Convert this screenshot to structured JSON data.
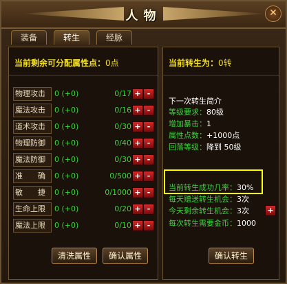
{
  "window": {
    "title": "人物",
    "close_label": "✕"
  },
  "tabs": [
    {
      "label": "装备"
    },
    {
      "label": "转生"
    },
    {
      "label": "经脉"
    }
  ],
  "left": {
    "points_label": "当前剩余可分配属性点：",
    "points_value": "0点",
    "attributes": [
      {
        "name": "物理攻击",
        "current": "0 (+0)",
        "max": "0/17"
      },
      {
        "name": "魔法攻击",
        "current": "0 (+0)",
        "max": "0/16"
      },
      {
        "name": "道术攻击",
        "current": "0 (+0)",
        "max": "0/30"
      },
      {
        "name": "物理防御",
        "current": "0 (+0)",
        "max": "0/40"
      },
      {
        "name": "魔法防御",
        "current": "0 (+0)",
        "max": "0/30"
      },
      {
        "name": "准　　确",
        "current": "0 (+0)",
        "max": "0/500"
      },
      {
        "name": "敏　　捷",
        "current": "0 (+0)",
        "max": "0/1000"
      },
      {
        "name": "生命上限",
        "current": "0 (+0)",
        "max": "0/20"
      },
      {
        "name": "魔法上限",
        "current": "0 (+0)",
        "max": "0/10"
      }
    ],
    "plus_label": "+",
    "minus_label": "-",
    "reset_button": "清洗属性",
    "confirm_button": "确认属性"
  },
  "right": {
    "rebirth_label": "当前转生为：",
    "rebirth_value": "0转",
    "next_title": "下一次转生简介",
    "level_req_label": "等级要求：",
    "level_req_value": "80级",
    "crit_label": "增加暴击：",
    "crit_value": "1",
    "points_label": "属性点数：",
    "points_value": "+1000点",
    "fallback_label": "回落等级：",
    "fallback_value": "降到 50级",
    "success_label": "当前转生成功几率：",
    "success_value": "30%",
    "daily_label": "每天赠送转生机会：",
    "daily_value": "3次",
    "remaining_label": "今天剩余转生机会：",
    "remaining_value": "3次",
    "cost_label": "每次转生需要金币：",
    "cost_value": "1000",
    "confirm_button": "确认转生",
    "plus_label": "+"
  },
  "colors": {
    "accent_green": "#3fd23f",
    "header_yellow": "#f1de2a",
    "highlight": "#ffff00",
    "button_red": "#d12a2a"
  }
}
